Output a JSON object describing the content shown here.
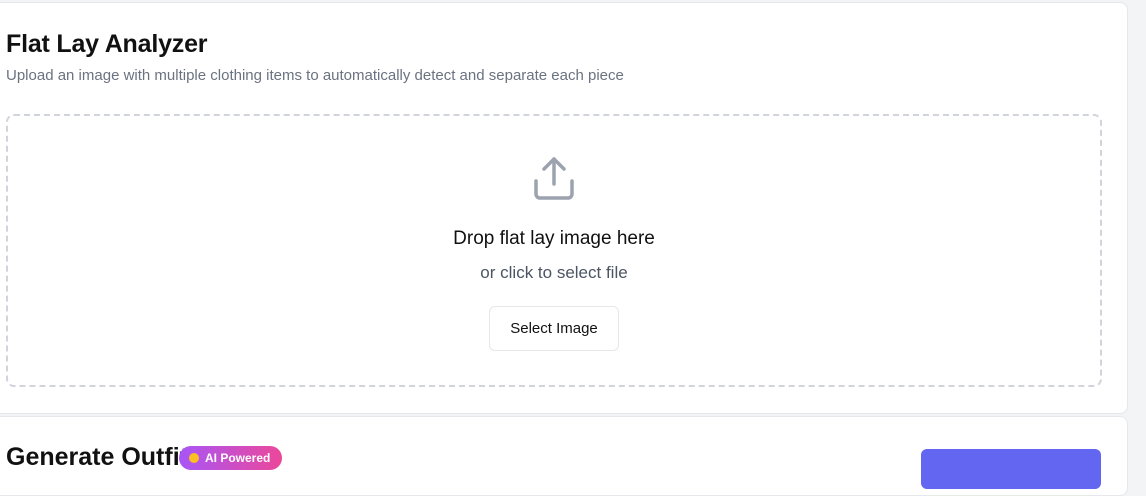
{
  "analyzer": {
    "title": "Flat Lay Analyzer",
    "subtitle": "Upload an image with multiple clothing items to automatically detect and separate each piece",
    "dropzone": {
      "icon": "upload-icon",
      "title": "Drop flat lay image here",
      "subtitle": "or click to select file",
      "button_label": "Select Image"
    }
  },
  "generate": {
    "title": "Generate Outfit",
    "badge": "AI Powered"
  },
  "colors": {
    "accent": "#6366f1",
    "badge_gradient_start": "#a855f7",
    "badge_gradient_end": "#ec4899",
    "muted_text": "#6b7280",
    "dropzone_border": "#d1d5db"
  }
}
